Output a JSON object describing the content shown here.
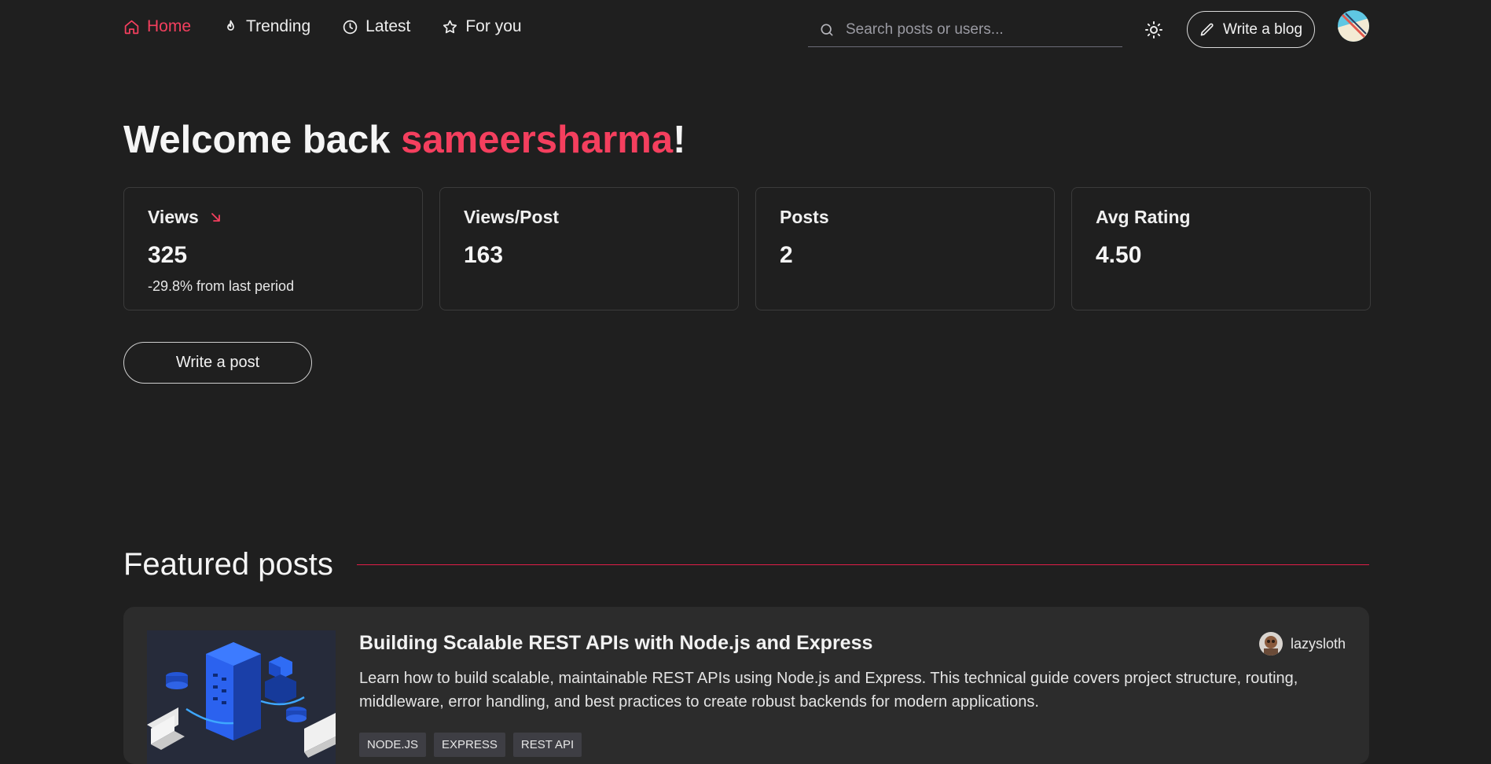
{
  "nav": {
    "items": [
      {
        "label": "Home",
        "icon": "home-icon",
        "active": true
      },
      {
        "label": "Trending",
        "icon": "flame-icon"
      },
      {
        "label": "Latest",
        "icon": "clock-icon"
      },
      {
        "label": "For you",
        "icon": "star-icon"
      }
    ]
  },
  "search": {
    "placeholder": "Search posts or users..."
  },
  "header": {
    "write_blog_label": "Write a blog"
  },
  "welcome": {
    "prefix": "Welcome back ",
    "username": "sameersharma",
    "suffix": "!"
  },
  "stats": [
    {
      "label": "Views",
      "value": "325",
      "delta": "-29.8% from last period",
      "trend": "down"
    },
    {
      "label": "Views/Post",
      "value": "163"
    },
    {
      "label": "Posts",
      "value": "2"
    },
    {
      "label": "Avg Rating",
      "value": "4.50"
    }
  ],
  "write_post_label": "Write a post",
  "featured": {
    "title": "Featured posts",
    "posts": [
      {
        "title": "Building Scalable REST APIs with Node.js and Express",
        "author": "lazysloth",
        "description": "Learn how to build scalable, maintainable REST APIs using Node.js and Express. This technical guide covers project structure, routing, middleware, error handling, and best practices to create robust backends for modern applications.",
        "tags": [
          "NODE.JS",
          "EXPRESS",
          "REST API"
        ]
      }
    ]
  },
  "colors": {
    "accent": "#f43f5e",
    "background": "#1f1f1f",
    "card": "#2c2c2c"
  }
}
